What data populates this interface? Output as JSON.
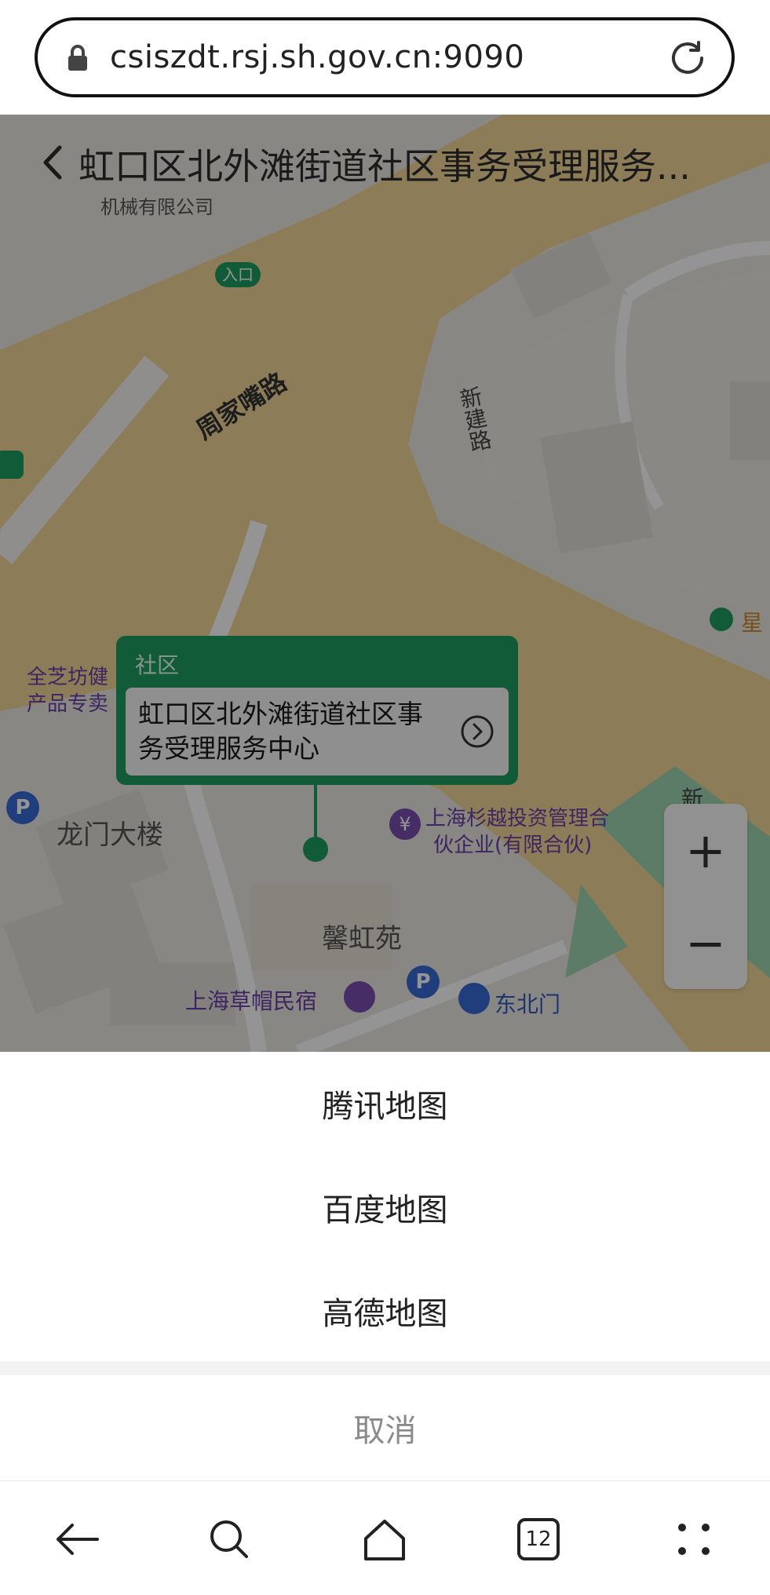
{
  "browser": {
    "url": "csiszdt.rsj.sh.gov.cn:9090",
    "tabs_count": "12"
  },
  "page": {
    "title": "虹口区北外滩街道社区事务受理服务..."
  },
  "map": {
    "labels": {
      "road_zhoujiazui": "周家嘴路",
      "road_xinjian": "新建路",
      "entrance": "入口",
      "company_top": "机械有限公司",
      "poi_quanzhifang": "全芝坊健",
      "poi_chanpin": "产品专卖",
      "longmen": "龙门大楼",
      "shanyue": "上海杉越投资管理合",
      "shanyue2": "伙企业(有限合伙)",
      "xinhongyuan": "馨虹苑",
      "caomao": "上海草帽民宿",
      "dongbeimen": "东北门",
      "xin_right": "新",
      "star_right": "星"
    },
    "callout": {
      "category": "社区",
      "name": "虹口区北外滩街道社区事务受理服务中心"
    },
    "zoom": {
      "in_label": "+",
      "out_label": "−"
    },
    "colors": {
      "accent_green": "#1e9d62",
      "road_yellow": "#f1d898",
      "poi_purple": "#7a4fb0",
      "parking_blue": "#3a6cd6"
    }
  },
  "sheet": {
    "options": [
      "腾讯地图",
      "百度地图",
      "高德地图"
    ],
    "cancel": "取消"
  },
  "nav_icons": [
    "back-icon",
    "search-icon",
    "home-icon",
    "tabs-icon",
    "menu-icon"
  ]
}
